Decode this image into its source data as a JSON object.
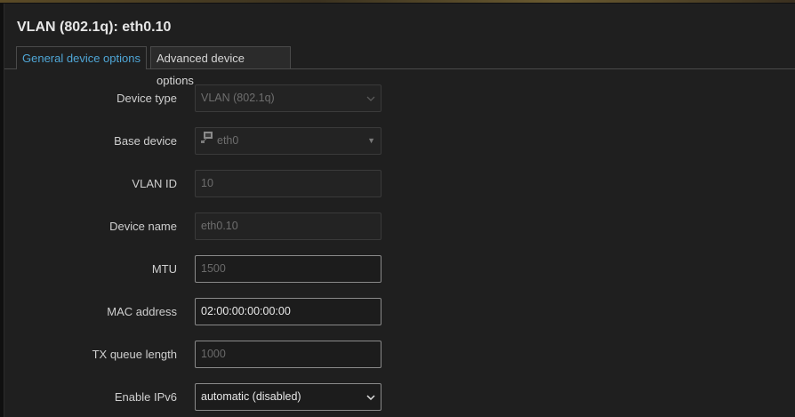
{
  "dialog": {
    "title": "VLAN (802.1q): eth0.10"
  },
  "tabs": [
    {
      "label": "General device options",
      "active": true
    },
    {
      "label": "Advanced device options",
      "active": false
    }
  ],
  "form": {
    "device_type": {
      "label": "Device type",
      "value": "VLAN (802.1q)"
    },
    "base_device": {
      "label": "Base device",
      "value": "eth0",
      "icon": "ethernet-port-icon"
    },
    "vlan_id": {
      "label": "VLAN ID",
      "value": "10"
    },
    "device_name": {
      "label": "Device name",
      "value": "eth0.10"
    },
    "mtu": {
      "label": "MTU",
      "placeholder": "1500"
    },
    "mac_address": {
      "label": "MAC address",
      "value": "02:00:00:00:00:00"
    },
    "tx_queue_length": {
      "label": "TX queue length",
      "placeholder": "1000"
    },
    "enable_ipv6": {
      "label": "Enable IPv6",
      "value": "automatic (disabled)"
    }
  },
  "colors": {
    "accent": "#4fa6d6",
    "background": "#1f1f1f",
    "text": "#cfcfcf"
  }
}
